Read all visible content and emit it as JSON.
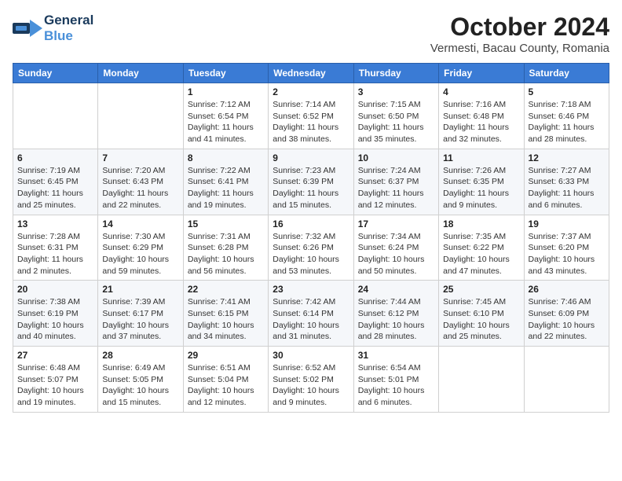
{
  "logo": {
    "general": "General",
    "blue": "Blue"
  },
  "title": "October 2024",
  "location": "Vermesti, Bacau County, Romania",
  "days_of_week": [
    "Sunday",
    "Monday",
    "Tuesday",
    "Wednesday",
    "Thursday",
    "Friday",
    "Saturday"
  ],
  "weeks": [
    [
      {
        "day": "",
        "sunrise": "",
        "sunset": "",
        "daylight": ""
      },
      {
        "day": "",
        "sunrise": "",
        "sunset": "",
        "daylight": ""
      },
      {
        "day": "1",
        "sunrise": "Sunrise: 7:12 AM",
        "sunset": "Sunset: 6:54 PM",
        "daylight": "Daylight: 11 hours and 41 minutes."
      },
      {
        "day": "2",
        "sunrise": "Sunrise: 7:14 AM",
        "sunset": "Sunset: 6:52 PM",
        "daylight": "Daylight: 11 hours and 38 minutes."
      },
      {
        "day": "3",
        "sunrise": "Sunrise: 7:15 AM",
        "sunset": "Sunset: 6:50 PM",
        "daylight": "Daylight: 11 hours and 35 minutes."
      },
      {
        "day": "4",
        "sunrise": "Sunrise: 7:16 AM",
        "sunset": "Sunset: 6:48 PM",
        "daylight": "Daylight: 11 hours and 32 minutes."
      },
      {
        "day": "5",
        "sunrise": "Sunrise: 7:18 AM",
        "sunset": "Sunset: 6:46 PM",
        "daylight": "Daylight: 11 hours and 28 minutes."
      }
    ],
    [
      {
        "day": "6",
        "sunrise": "Sunrise: 7:19 AM",
        "sunset": "Sunset: 6:45 PM",
        "daylight": "Daylight: 11 hours and 25 minutes."
      },
      {
        "day": "7",
        "sunrise": "Sunrise: 7:20 AM",
        "sunset": "Sunset: 6:43 PM",
        "daylight": "Daylight: 11 hours and 22 minutes."
      },
      {
        "day": "8",
        "sunrise": "Sunrise: 7:22 AM",
        "sunset": "Sunset: 6:41 PM",
        "daylight": "Daylight: 11 hours and 19 minutes."
      },
      {
        "day": "9",
        "sunrise": "Sunrise: 7:23 AM",
        "sunset": "Sunset: 6:39 PM",
        "daylight": "Daylight: 11 hours and 15 minutes."
      },
      {
        "day": "10",
        "sunrise": "Sunrise: 7:24 AM",
        "sunset": "Sunset: 6:37 PM",
        "daylight": "Daylight: 11 hours and 12 minutes."
      },
      {
        "day": "11",
        "sunrise": "Sunrise: 7:26 AM",
        "sunset": "Sunset: 6:35 PM",
        "daylight": "Daylight: 11 hours and 9 minutes."
      },
      {
        "day": "12",
        "sunrise": "Sunrise: 7:27 AM",
        "sunset": "Sunset: 6:33 PM",
        "daylight": "Daylight: 11 hours and 6 minutes."
      }
    ],
    [
      {
        "day": "13",
        "sunrise": "Sunrise: 7:28 AM",
        "sunset": "Sunset: 6:31 PM",
        "daylight": "Daylight: 11 hours and 2 minutes."
      },
      {
        "day": "14",
        "sunrise": "Sunrise: 7:30 AM",
        "sunset": "Sunset: 6:29 PM",
        "daylight": "Daylight: 10 hours and 59 minutes."
      },
      {
        "day": "15",
        "sunrise": "Sunrise: 7:31 AM",
        "sunset": "Sunset: 6:28 PM",
        "daylight": "Daylight: 10 hours and 56 minutes."
      },
      {
        "day": "16",
        "sunrise": "Sunrise: 7:32 AM",
        "sunset": "Sunset: 6:26 PM",
        "daylight": "Daylight: 10 hours and 53 minutes."
      },
      {
        "day": "17",
        "sunrise": "Sunrise: 7:34 AM",
        "sunset": "Sunset: 6:24 PM",
        "daylight": "Daylight: 10 hours and 50 minutes."
      },
      {
        "day": "18",
        "sunrise": "Sunrise: 7:35 AM",
        "sunset": "Sunset: 6:22 PM",
        "daylight": "Daylight: 10 hours and 47 minutes."
      },
      {
        "day": "19",
        "sunrise": "Sunrise: 7:37 AM",
        "sunset": "Sunset: 6:20 PM",
        "daylight": "Daylight: 10 hours and 43 minutes."
      }
    ],
    [
      {
        "day": "20",
        "sunrise": "Sunrise: 7:38 AM",
        "sunset": "Sunset: 6:19 PM",
        "daylight": "Daylight: 10 hours and 40 minutes."
      },
      {
        "day": "21",
        "sunrise": "Sunrise: 7:39 AM",
        "sunset": "Sunset: 6:17 PM",
        "daylight": "Daylight: 10 hours and 37 minutes."
      },
      {
        "day": "22",
        "sunrise": "Sunrise: 7:41 AM",
        "sunset": "Sunset: 6:15 PM",
        "daylight": "Daylight: 10 hours and 34 minutes."
      },
      {
        "day": "23",
        "sunrise": "Sunrise: 7:42 AM",
        "sunset": "Sunset: 6:14 PM",
        "daylight": "Daylight: 10 hours and 31 minutes."
      },
      {
        "day": "24",
        "sunrise": "Sunrise: 7:44 AM",
        "sunset": "Sunset: 6:12 PM",
        "daylight": "Daylight: 10 hours and 28 minutes."
      },
      {
        "day": "25",
        "sunrise": "Sunrise: 7:45 AM",
        "sunset": "Sunset: 6:10 PM",
        "daylight": "Daylight: 10 hours and 25 minutes."
      },
      {
        "day": "26",
        "sunrise": "Sunrise: 7:46 AM",
        "sunset": "Sunset: 6:09 PM",
        "daylight": "Daylight: 10 hours and 22 minutes."
      }
    ],
    [
      {
        "day": "27",
        "sunrise": "Sunrise: 6:48 AM",
        "sunset": "Sunset: 5:07 PM",
        "daylight": "Daylight: 10 hours and 19 minutes."
      },
      {
        "day": "28",
        "sunrise": "Sunrise: 6:49 AM",
        "sunset": "Sunset: 5:05 PM",
        "daylight": "Daylight: 10 hours and 15 minutes."
      },
      {
        "day": "29",
        "sunrise": "Sunrise: 6:51 AM",
        "sunset": "Sunset: 5:04 PM",
        "daylight": "Daylight: 10 hours and 12 minutes."
      },
      {
        "day": "30",
        "sunrise": "Sunrise: 6:52 AM",
        "sunset": "Sunset: 5:02 PM",
        "daylight": "Daylight: 10 hours and 9 minutes."
      },
      {
        "day": "31",
        "sunrise": "Sunrise: 6:54 AM",
        "sunset": "Sunset: 5:01 PM",
        "daylight": "Daylight: 10 hours and 6 minutes."
      },
      {
        "day": "",
        "sunrise": "",
        "sunset": "",
        "daylight": ""
      },
      {
        "day": "",
        "sunrise": "",
        "sunset": "",
        "daylight": ""
      }
    ]
  ]
}
